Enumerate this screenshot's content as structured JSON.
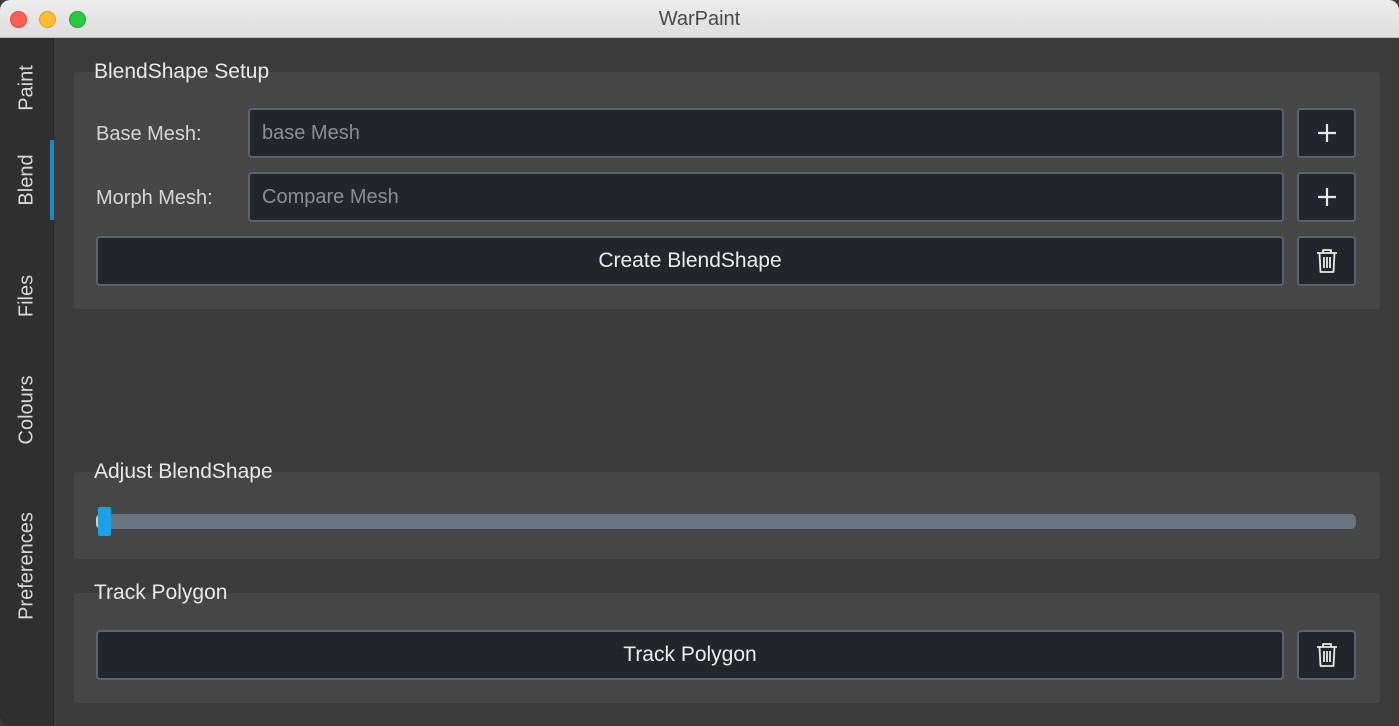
{
  "window": {
    "title": "WarPaint"
  },
  "sidebar": {
    "tabs": [
      {
        "label": "Paint",
        "active": false
      },
      {
        "label": "Blend",
        "active": true
      },
      {
        "label": "Files",
        "active": false
      },
      {
        "label": "Colours",
        "active": false
      },
      {
        "label": "Preferences",
        "active": false
      }
    ]
  },
  "blendshape_setup": {
    "title": "BlendShape Setup",
    "base_mesh": {
      "label": "Base Mesh:",
      "value": "",
      "placeholder": "base Mesh",
      "add_icon": "plus-icon"
    },
    "morph_mesh": {
      "label": "Morph Mesh:",
      "value": "",
      "placeholder": "Compare Mesh",
      "add_icon": "plus-icon"
    },
    "create_button": "Create BlendShape",
    "delete_icon": "trash-icon"
  },
  "adjust_blendshape": {
    "title": "Adjust BlendShape",
    "slider_value": 0.0
  },
  "track_polygon": {
    "title": "Track Polygon",
    "button": "Track Polygon",
    "delete_icon": "trash-icon"
  },
  "colors": {
    "accent": "#1aa1e6",
    "active_tab_indicator": "#1e88c7",
    "panel_bg": "#464646",
    "input_bg": "#22262a"
  }
}
